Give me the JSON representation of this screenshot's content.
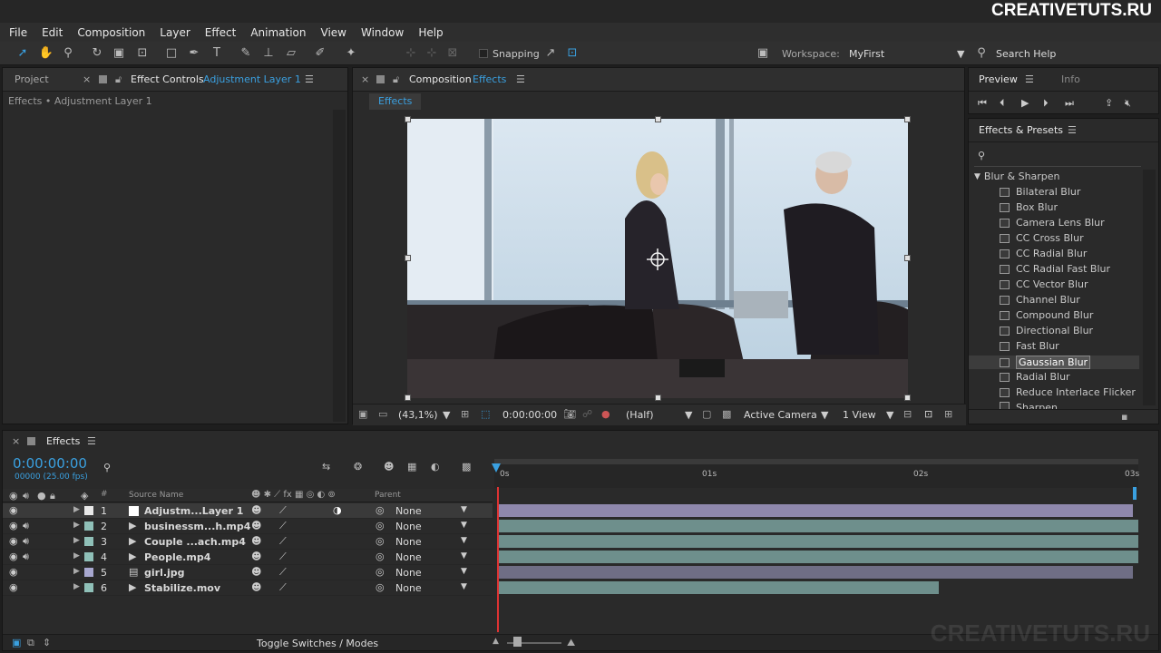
{
  "watermark": "CREATIVETUTS.RU",
  "menu": [
    "File",
    "Edit",
    "Composition",
    "Layer",
    "Effect",
    "Animation",
    "View",
    "Window",
    "Help"
  ],
  "toolbar": {
    "snapping": "Snapping",
    "workspace_label": "Workspace:",
    "workspace_value": "MyFirst",
    "search_help": "Search Help"
  },
  "project_panel": {
    "tab_project": "Project",
    "tab_effect_controls": "Effect Controls",
    "effect_controls_target": "Adjustment Layer 1",
    "breadcrumb": "Effects • Adjustment Layer 1"
  },
  "comp_panel": {
    "tab_label": "Composition",
    "comp_name": "Effects",
    "comp_tab": "Effects",
    "zoom": "(43,1%)",
    "timecode": "0:00:00:00",
    "resolution": "(Half)",
    "camera": "Active Camera",
    "views": "1 View"
  },
  "preview_panel": {
    "tab_preview": "Preview",
    "tab_info": "Info"
  },
  "effects_panel": {
    "title": "Effects & Presets",
    "category": "Blur & Sharpen",
    "items": [
      "Bilateral Blur",
      "Box Blur",
      "Camera Lens Blur",
      "CC Cross Blur",
      "CC Radial Blur",
      "CC Radial Fast Blur",
      "CC Vector Blur",
      "Channel Blur",
      "Compound Blur",
      "Directional Blur",
      "Fast Blur",
      "Gaussian Blur",
      "Radial Blur",
      "Reduce Interlace Flicker",
      "Sharpen"
    ],
    "selected": "Gaussian Blur"
  },
  "timeline": {
    "tab": "Effects",
    "timecode": "0:00:00:00",
    "frames": "00000 (25.00 fps)",
    "col_source": "Source Name",
    "col_parent": "Parent",
    "col_hash": "#",
    "ruler": [
      "0s",
      "01s",
      "02s",
      "03s"
    ],
    "toggle": "Toggle Switches / Modes",
    "layers": [
      {
        "num": "1",
        "name": "Adjustm...Layer 1",
        "parent": "None",
        "color": "#e8e8e8"
      },
      {
        "num": "2",
        "name": "businessm...h.mp4",
        "parent": "None",
        "color": "#8fc0b8"
      },
      {
        "num": "3",
        "name": "Couple ...ach.mp4",
        "parent": "None",
        "color": "#8fc0b8"
      },
      {
        "num": "4",
        "name": "People.mp4",
        "parent": "None",
        "color": "#8fc0b8"
      },
      {
        "num": "5",
        "name": "girl.jpg",
        "parent": "None",
        "color": "#a8a8d0"
      },
      {
        "num": "6",
        "name": "Stabilize.mov",
        "parent": "None",
        "color": "#8fc0b8"
      }
    ]
  }
}
